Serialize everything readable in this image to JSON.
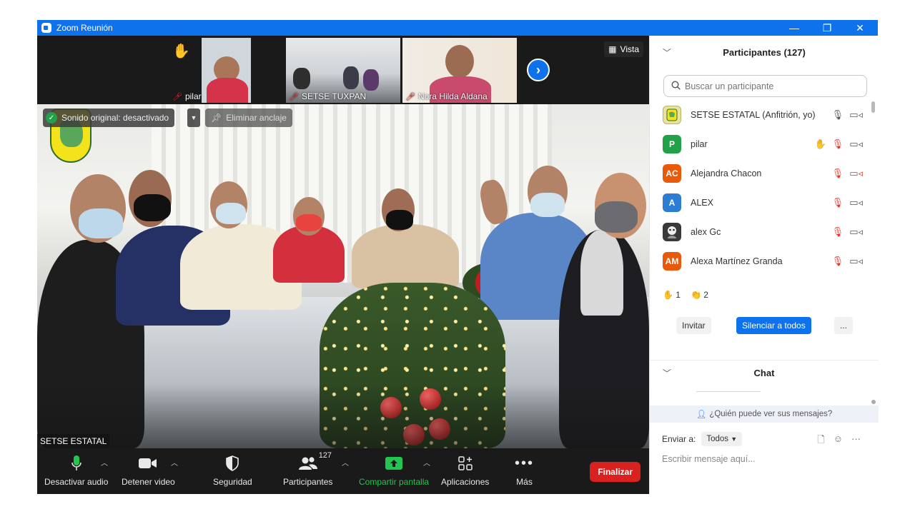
{
  "window": {
    "title": "Zoom Reunión",
    "minimize": "—",
    "restore": "❐",
    "close": "✕"
  },
  "thumbnails": [
    {
      "name": "pilar",
      "raised_hand": "✋"
    },
    {
      "name": "SETSE TUXPAN"
    },
    {
      "name": "Nora Hilda Aldana"
    }
  ],
  "gallery": {
    "vista_label": "Vista",
    "next_arrow": "›"
  },
  "main_video": {
    "original_sound": "Sonido original: desactivado",
    "unpin": "Eliminar anclaje",
    "speaker": "SETSE ESTATAL"
  },
  "toolbar": {
    "audio": "Desactivar audio",
    "video": "Detener video",
    "security": "Seguridad",
    "participants": "Participantes",
    "participants_count": "127",
    "share": "Compartir pantalla",
    "apps": "Aplicaciones",
    "more": "Más",
    "end": "Finalizar"
  },
  "participants_panel": {
    "title": "Participantes (127)",
    "search_placeholder": "Buscar un participante",
    "items": [
      {
        "initials": "",
        "name": "SETSE ESTATAL (Anfitrión, yo)",
        "avatar_color": "#e8e4a0",
        "mic": "on",
        "video": "on"
      },
      {
        "initials": "P",
        "name": "pilar",
        "avatar_color": "#23a148",
        "hand": "✋",
        "mic": "muted",
        "video": "on"
      },
      {
        "initials": "AC",
        "name": "Alejandra Chacon",
        "avatar_color": "#e8590c",
        "mic": "muted",
        "video": "off"
      },
      {
        "initials": "A",
        "name": "ALEX",
        "avatar_color": "#2d7dd2",
        "mic": "muted",
        "video": "on"
      },
      {
        "initials": "",
        "name": "alex Gc",
        "avatar_color": "#3a3a3a",
        "mic": "muted",
        "video": "on"
      },
      {
        "initials": "AM",
        "name": "Alexa Martínez Granda",
        "avatar_color": "#e8590c",
        "mic": "muted",
        "video": "on"
      }
    ],
    "reactions": {
      "hand_emoji": "✋",
      "hand_count": "1",
      "clap_emoji": "👏",
      "clap_count": "2"
    },
    "invite": "Invitar",
    "mute_all": "Silenciar a todos",
    "more": "..."
  },
  "chat": {
    "title": "Chat",
    "who_sees": "¿Quién puede ver sus mensajes?",
    "send_to_label": "Enviar a:",
    "send_to_value": "Todos",
    "input_placeholder": "Escribir mensaje aquí..."
  },
  "colors": {
    "zoom_blue": "#0e72ed",
    "end_red": "#d9221f",
    "share_green": "#23c552",
    "muted_red": "#e0362c"
  }
}
